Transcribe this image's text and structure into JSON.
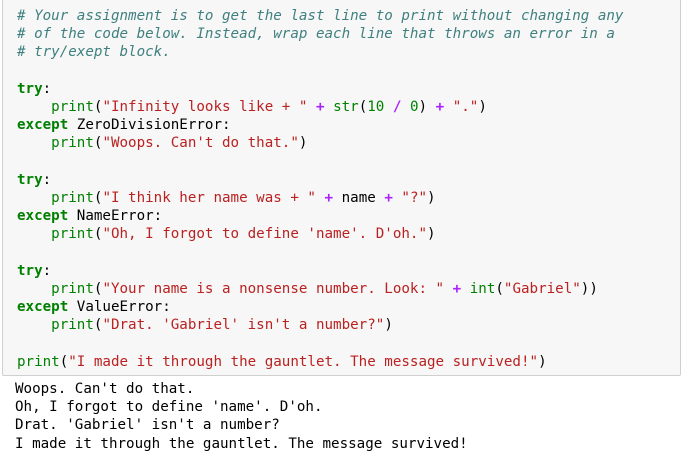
{
  "input_cell": {
    "lines": [
      {
        "parts": [
          {
            "t": "# Your assignment is to get the last line to print without changing any",
            "c": "comment"
          }
        ]
      },
      {
        "parts": [
          {
            "t": "# of the code below. Instead, wrap each line that throws an error in a",
            "c": "comment"
          }
        ]
      },
      {
        "parts": [
          {
            "t": "# try/exept block.",
            "c": "comment"
          }
        ]
      },
      {
        "parts": []
      },
      {
        "parts": [
          {
            "t": "try",
            "c": "kw"
          },
          {
            "t": ":",
            "c": "name"
          }
        ]
      },
      {
        "parts": [
          {
            "t": "    ",
            "c": "name"
          },
          {
            "t": "print",
            "c": "bi"
          },
          {
            "t": "(",
            "c": "name"
          },
          {
            "t": "\"Infinity looks like + \"",
            "c": "str"
          },
          {
            "t": " ",
            "c": "name"
          },
          {
            "t": "+",
            "c": "op"
          },
          {
            "t": " ",
            "c": "name"
          },
          {
            "t": "str",
            "c": "bi"
          },
          {
            "t": "(",
            "c": "name"
          },
          {
            "t": "10",
            "c": "num"
          },
          {
            "t": " ",
            "c": "name"
          },
          {
            "t": "/",
            "c": "op"
          },
          {
            "t": " ",
            "c": "name"
          },
          {
            "t": "0",
            "c": "num"
          },
          {
            "t": ") ",
            "c": "name"
          },
          {
            "t": "+",
            "c": "op"
          },
          {
            "t": " ",
            "c": "name"
          },
          {
            "t": "\".\"",
            "c": "str"
          },
          {
            "t": ")",
            "c": "name"
          }
        ]
      },
      {
        "parts": [
          {
            "t": "except",
            "c": "kw"
          },
          {
            "t": " ",
            "c": "name"
          },
          {
            "t": "ZeroDivisionError",
            "c": "name"
          },
          {
            "t": ":",
            "c": "name"
          }
        ]
      },
      {
        "parts": [
          {
            "t": "    ",
            "c": "name"
          },
          {
            "t": "print",
            "c": "bi"
          },
          {
            "t": "(",
            "c": "name"
          },
          {
            "t": "\"Woops. Can't do that.\"",
            "c": "str"
          },
          {
            "t": ")",
            "c": "name"
          }
        ]
      },
      {
        "parts": []
      },
      {
        "parts": [
          {
            "t": "try",
            "c": "kw"
          },
          {
            "t": ":",
            "c": "name"
          }
        ]
      },
      {
        "parts": [
          {
            "t": "    ",
            "c": "name"
          },
          {
            "t": "print",
            "c": "bi"
          },
          {
            "t": "(",
            "c": "name"
          },
          {
            "t": "\"I think her name was + \"",
            "c": "str"
          },
          {
            "t": " ",
            "c": "name"
          },
          {
            "t": "+",
            "c": "op"
          },
          {
            "t": " name ",
            "c": "name"
          },
          {
            "t": "+",
            "c": "op"
          },
          {
            "t": " ",
            "c": "name"
          },
          {
            "t": "\"?\"",
            "c": "str"
          },
          {
            "t": ")",
            "c": "name"
          }
        ]
      },
      {
        "parts": [
          {
            "t": "except",
            "c": "kw"
          },
          {
            "t": " ",
            "c": "name"
          },
          {
            "t": "NameError",
            "c": "name"
          },
          {
            "t": ":",
            "c": "name"
          }
        ]
      },
      {
        "parts": [
          {
            "t": "    ",
            "c": "name"
          },
          {
            "t": "print",
            "c": "bi"
          },
          {
            "t": "(",
            "c": "name"
          },
          {
            "t": "\"Oh, I forgot to define 'name'. D'oh.\"",
            "c": "str"
          },
          {
            "t": ")",
            "c": "name"
          }
        ]
      },
      {
        "parts": []
      },
      {
        "parts": [
          {
            "t": "try",
            "c": "kw"
          },
          {
            "t": ":",
            "c": "name"
          }
        ]
      },
      {
        "parts": [
          {
            "t": "    ",
            "c": "name"
          },
          {
            "t": "print",
            "c": "bi"
          },
          {
            "t": "(",
            "c": "name"
          },
          {
            "t": "\"Your name is a nonsense number. Look: \"",
            "c": "str"
          },
          {
            "t": " ",
            "c": "name"
          },
          {
            "t": "+",
            "c": "op"
          },
          {
            "t": " ",
            "c": "name"
          },
          {
            "t": "int",
            "c": "bi"
          },
          {
            "t": "(",
            "c": "name"
          },
          {
            "t": "\"Gabriel\"",
            "c": "str"
          },
          {
            "t": "))",
            "c": "name"
          }
        ]
      },
      {
        "parts": [
          {
            "t": "except",
            "c": "kw"
          },
          {
            "t": " ",
            "c": "name"
          },
          {
            "t": "ValueError",
            "c": "name"
          },
          {
            "t": ":",
            "c": "name"
          }
        ]
      },
      {
        "parts": [
          {
            "t": "    ",
            "c": "name"
          },
          {
            "t": "print",
            "c": "bi"
          },
          {
            "t": "(",
            "c": "name"
          },
          {
            "t": "\"Drat. 'Gabriel' isn't a number?\"",
            "c": "str"
          },
          {
            "t": ")",
            "c": "name"
          }
        ]
      },
      {
        "parts": []
      },
      {
        "parts": [
          {
            "t": "print",
            "c": "bi"
          },
          {
            "t": "(",
            "c": "name"
          },
          {
            "t": "\"I made it through the gauntlet. The message survived!\"",
            "c": "str"
          },
          {
            "t": ")",
            "c": "name"
          }
        ]
      }
    ]
  },
  "output_cell": {
    "lines": [
      "Woops. Can't do that.",
      "Oh, I forgot to define 'name'. D'oh.",
      "Drat. 'Gabriel' isn't a number?",
      "I made it through the gauntlet. The message survived!"
    ]
  },
  "colors": {
    "comment": "#408080",
    "keyword": "#008000",
    "string": "#ba2121",
    "operator": "#aa22ff",
    "cell_background": "#f7f7f7",
    "cell_border": "#cfcfcf"
  }
}
